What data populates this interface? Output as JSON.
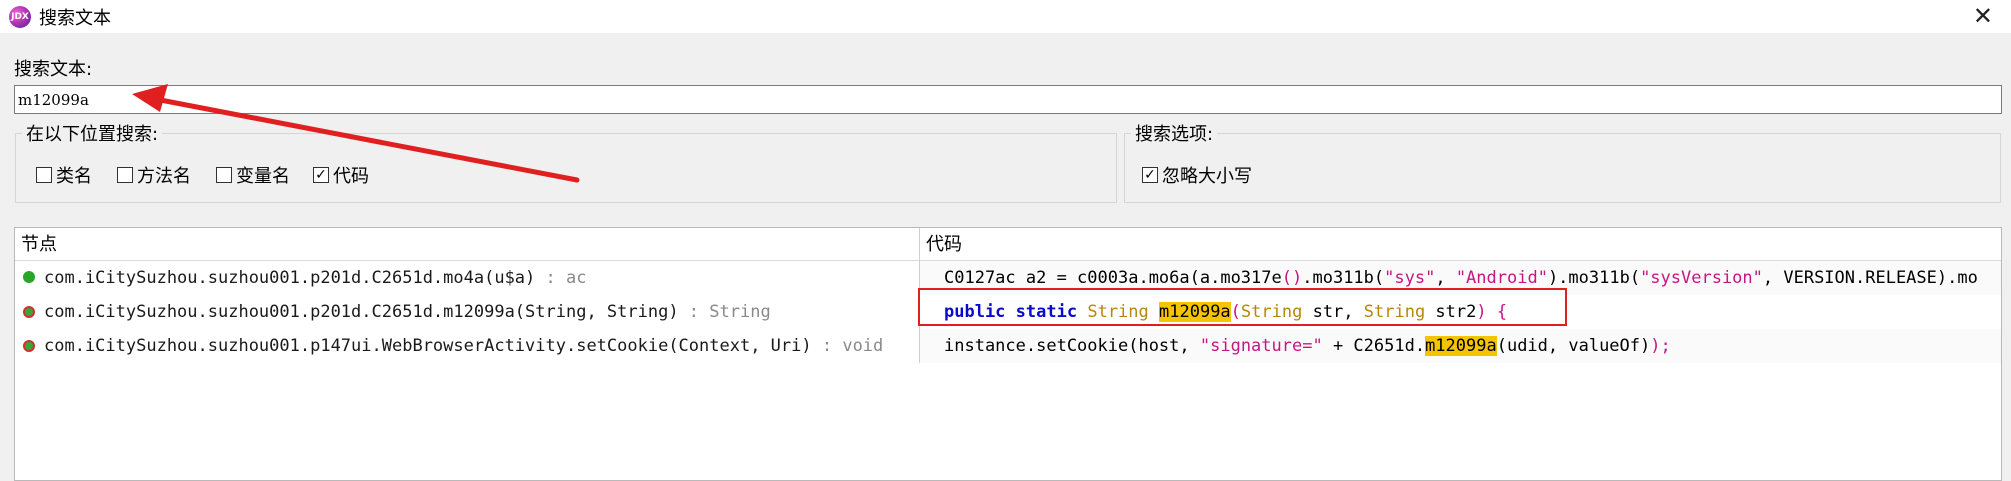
{
  "window": {
    "title": "搜索文本",
    "app_icon_text": "JDX"
  },
  "search": {
    "label": "搜索文本:",
    "value": "m12099a"
  },
  "location_group": {
    "title": "在以下位置搜索:",
    "options": [
      {
        "label": "类名",
        "checked": false
      },
      {
        "label": "方法名",
        "checked": false
      },
      {
        "label": "变量名",
        "checked": false
      },
      {
        "label": "代码",
        "checked": true
      }
    ]
  },
  "options_group": {
    "title": "搜索选项:",
    "options": [
      {
        "label": "忽略大小写",
        "checked": true
      }
    ]
  },
  "results": {
    "columns": [
      "节点",
      "代码"
    ],
    "rows": [
      {
        "node": "com.iCitySuzhou.suzhou001.p201d.C2651d.mo4a(u$a)",
        "node_type": " : ac",
        "icon": "green-dot-icon",
        "code_parts": [
          {
            "t": "C0127ac a2 = c0003a.mo6a(a.mo317e",
            "c": ""
          },
          {
            "t": "()",
            "c": "par"
          },
          {
            "t": ".mo311b(",
            "c": ""
          },
          {
            "t": "\"sys\"",
            "c": "str"
          },
          {
            "t": ", ",
            "c": ""
          },
          {
            "t": "\"Android\"",
            "c": "str"
          },
          {
            "t": ").mo311b(",
            "c": ""
          },
          {
            "t": "\"sysVersion\"",
            "c": "str"
          },
          {
            "t": ", VERSION.RELEASE).mo",
            "c": ""
          }
        ]
      },
      {
        "node": "com.iCitySuzhou.suzhou001.p201d.C2651d.m12099a(String, String)",
        "node_type": " : String",
        "icon": "static-method-icon",
        "code_parts": [
          {
            "t": "public",
            "c": "kw"
          },
          {
            "t": " ",
            "c": ""
          },
          {
            "t": "static",
            "c": "kw"
          },
          {
            "t": " ",
            "c": ""
          },
          {
            "t": "String",
            "c": "ty"
          },
          {
            "t": " ",
            "c": ""
          },
          {
            "t": "m12099a",
            "c": "hl"
          },
          {
            "t": "(",
            "c": "par"
          },
          {
            "t": "String",
            "c": "ty"
          },
          {
            "t": " str, ",
            "c": ""
          },
          {
            "t": "String",
            "c": "ty"
          },
          {
            "t": " str2",
            "c": ""
          },
          {
            "t": ") {",
            "c": "par"
          }
        ]
      },
      {
        "node": "com.iCitySuzhou.suzhou001.p147ui.WebBrowserActivity.setCookie(Context, Uri)",
        "node_type": " : void",
        "icon": "static-method-icon",
        "code_parts": [
          {
            "t": "instance.setCookie(host, ",
            "c": ""
          },
          {
            "t": "\"signature=\"",
            "c": "str"
          },
          {
            "t": " + C2651d.",
            "c": ""
          },
          {
            "t": "m12099a",
            "c": "hl"
          },
          {
            "t": "(udid, valueOf)",
            "c": ""
          },
          {
            "t": ");",
            "c": "par"
          }
        ]
      }
    ]
  },
  "colors": {
    "keyword": "#0a0acd",
    "type": "#b8860b",
    "string": "#c71585",
    "highlight": "#f5c400",
    "annotation": "#e02020"
  }
}
